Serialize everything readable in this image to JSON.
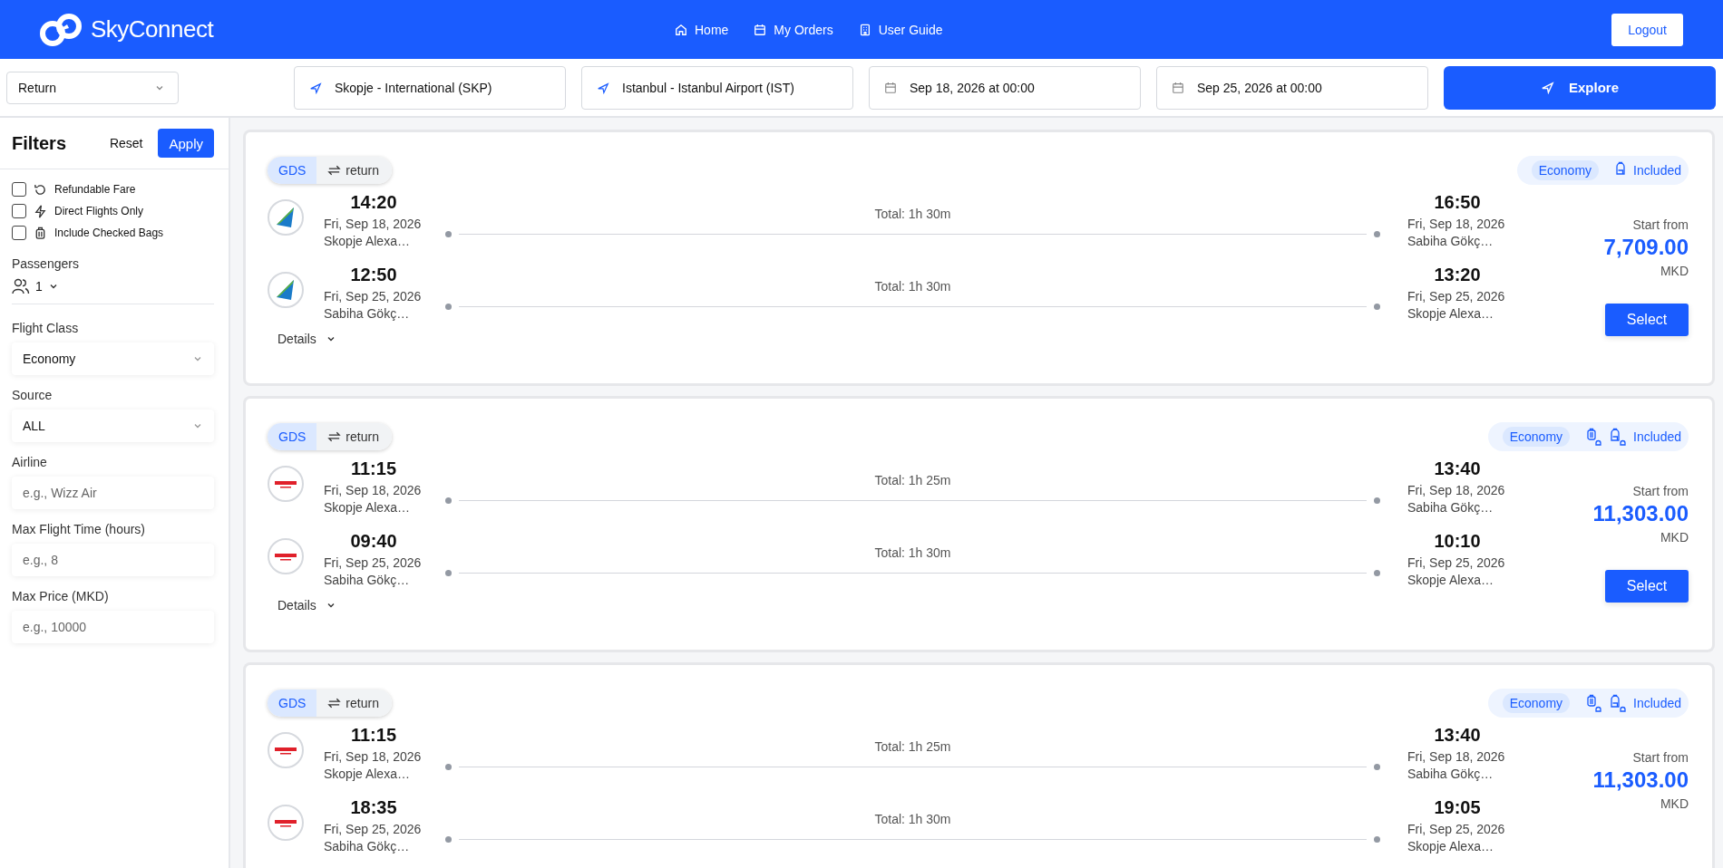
{
  "header": {
    "brand": "SkyConnect",
    "nav": [
      {
        "label": "Home",
        "kind": "home"
      },
      {
        "label": "My Orders",
        "kind": "orders"
      },
      {
        "label": "User Guide",
        "kind": "guide"
      }
    ],
    "logout": "Logout"
  },
  "search": {
    "trip_type": "Return",
    "from": "Skopje - International (SKP)",
    "to": "Istanbul - Istanbul Airport (IST)",
    "depart": "Sep 18, 2026 at 00:00",
    "return": "Sep 25, 2026 at 00:00",
    "explore": "Explore"
  },
  "filters": {
    "title": "Filters",
    "reset": "Reset",
    "apply": "Apply",
    "checks": [
      {
        "label": "Refundable Fare",
        "kind": "refund",
        "checked": false
      },
      {
        "label": "Direct Flights Only",
        "kind": "direct",
        "checked": false
      },
      {
        "label": "Include Checked Bags",
        "kind": "bags",
        "checked": false
      }
    ],
    "passengers_label": "Passengers",
    "passengers": "1",
    "fields": [
      {
        "label": "Flight Class",
        "kind": "select",
        "value": "Economy"
      },
      {
        "label": "Source",
        "kind": "select",
        "value": "ALL"
      },
      {
        "label": "Airline",
        "kind": "input",
        "placeholder": "e.g., Wizz Air"
      },
      {
        "label": "Max Flight Time (hours)",
        "kind": "input",
        "placeholder": "e.g., 8"
      },
      {
        "label": "Max Price (MKD)",
        "kind": "input",
        "placeholder": "e.g., 10000"
      }
    ]
  },
  "results": [
    {
      "source": "GDS",
      "trip": "return",
      "cabin": "Economy",
      "checked_bag": false,
      "baggage": "Included",
      "start_from": "Start from",
      "price": "7,709.00",
      "currency": "MKD",
      "select": "Select",
      "details": "Details",
      "segments": [
        {
          "kind": "blue-tail",
          "dep_time": "14:20",
          "dep_date": "Fri, Sep 18, 2026",
          "dep_airport": "Skopje Alexa…",
          "total": "Total: 1h 30m",
          "arr_time": "16:50",
          "arr_date": "Fri, Sep 18, 2026",
          "arr_airport": "Sabiha Gökç…"
        },
        {
          "kind": "blue-tail",
          "dep_time": "12:50",
          "dep_date": "Fri, Sep 25, 2026",
          "dep_airport": "Sabiha Gökç…",
          "total": "Total: 1h 30m",
          "arr_time": "13:20",
          "arr_date": "Fri, Sep 25, 2026",
          "arr_airport": "Skopje Alexa…"
        }
      ]
    },
    {
      "source": "GDS",
      "trip": "return",
      "cabin": "Economy",
      "checked_bag": true,
      "baggage": "Included",
      "start_from": "Start from",
      "price": "11,303.00",
      "currency": "MKD",
      "select": "Select",
      "details": "Details",
      "segments": [
        {
          "kind": "red-wordmark",
          "dep_time": "11:15",
          "dep_date": "Fri, Sep 18, 2026",
          "dep_airport": "Skopje Alexa…",
          "total": "Total: 1h 25m",
          "arr_time": "13:40",
          "arr_date": "Fri, Sep 18, 2026",
          "arr_airport": "Sabiha Gökç…"
        },
        {
          "kind": "red-wordmark",
          "dep_time": "09:40",
          "dep_date": "Fri, Sep 25, 2026",
          "dep_airport": "Sabiha Gökç…",
          "total": "Total: 1h 30m",
          "arr_time": "10:10",
          "arr_date": "Fri, Sep 25, 2026",
          "arr_airport": "Skopje Alexa…"
        }
      ]
    },
    {
      "source": "GDS",
      "trip": "return",
      "cabin": "Economy",
      "checked_bag": true,
      "baggage": "Included",
      "start_from": "Start from",
      "price": "11,303.00",
      "currency": "MKD",
      "segments": [
        {
          "kind": "red-wordmark",
          "dep_time": "11:15",
          "dep_date": "Fri, Sep 18, 2026",
          "dep_airport": "Skopje Alexa…",
          "total": "Total: 1h 25m",
          "arr_time": "13:40",
          "arr_date": "Fri, Sep 18, 2026",
          "arr_airport": "Sabiha Gökç…"
        },
        {
          "kind": "red-wordmark",
          "dep_time": "18:35",
          "dep_date": "Fri, Sep 25, 2026",
          "dep_airport": "Sabiha Gökç…",
          "total": "Total: 1h 30m",
          "arr_time": "19:05",
          "arr_date": "Fri, Sep 25, 2026",
          "arr_airport": "Skopje Alexa…"
        }
      ]
    }
  ]
}
